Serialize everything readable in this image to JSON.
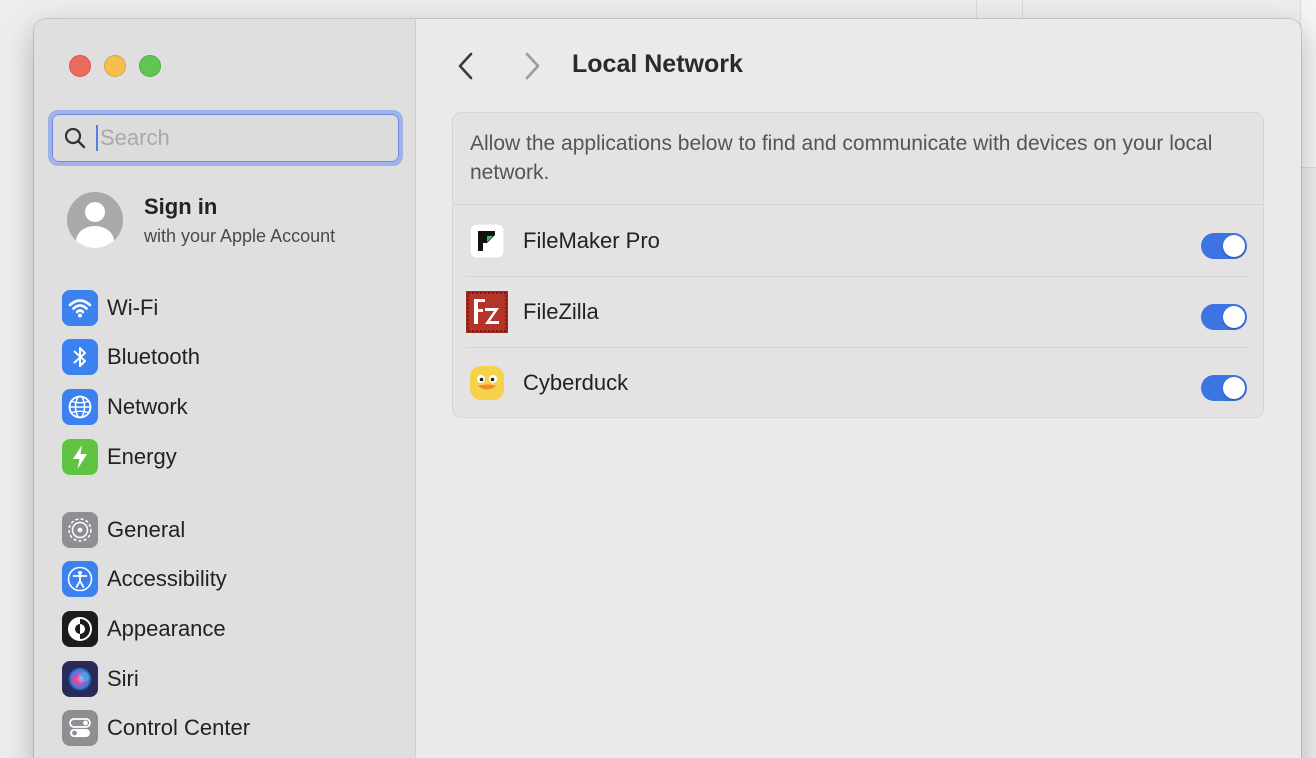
{
  "search": {
    "placeholder": "Search"
  },
  "account": {
    "title": "Sign in",
    "subtitle": "with your Apple Account"
  },
  "sidebar": {
    "group1": [
      {
        "label": "Wi-Fi",
        "icon": "wifi-icon",
        "color": "#3b82f0"
      },
      {
        "label": "Bluetooth",
        "icon": "bluetooth-icon",
        "color": "#3b82f0"
      },
      {
        "label": "Network",
        "icon": "globe-icon",
        "color": "#3b82f0"
      },
      {
        "label": "Energy",
        "icon": "bolt-icon",
        "color": "#5fc442"
      }
    ],
    "group2": [
      {
        "label": "General",
        "icon": "gear-icon",
        "color": "#8e8e93"
      },
      {
        "label": "Accessibility",
        "icon": "accessibility-icon",
        "color": "#3b82f0"
      },
      {
        "label": "Appearance",
        "icon": "appearance-icon",
        "color": "#1c1c1e"
      },
      {
        "label": "Siri",
        "icon": "siri-icon",
        "color": "#2b2b5a"
      },
      {
        "label": "Control Center",
        "icon": "control-center-icon",
        "color": "#8e8e93"
      }
    ]
  },
  "main": {
    "title": "Local Network",
    "description": "Allow the applications below to find and communicate with devices on your local network.",
    "apps": [
      {
        "name": "FileMaker Pro",
        "icon": "filemaker-icon",
        "enabled": true
      },
      {
        "name": "FileZilla",
        "icon": "filezilla-icon",
        "enabled": true
      },
      {
        "name": "Cyberduck",
        "icon": "cyberduck-icon",
        "enabled": true
      }
    ]
  },
  "colors": {
    "accent": "#3c74e4",
    "toggle_on": "#3c74e4"
  }
}
